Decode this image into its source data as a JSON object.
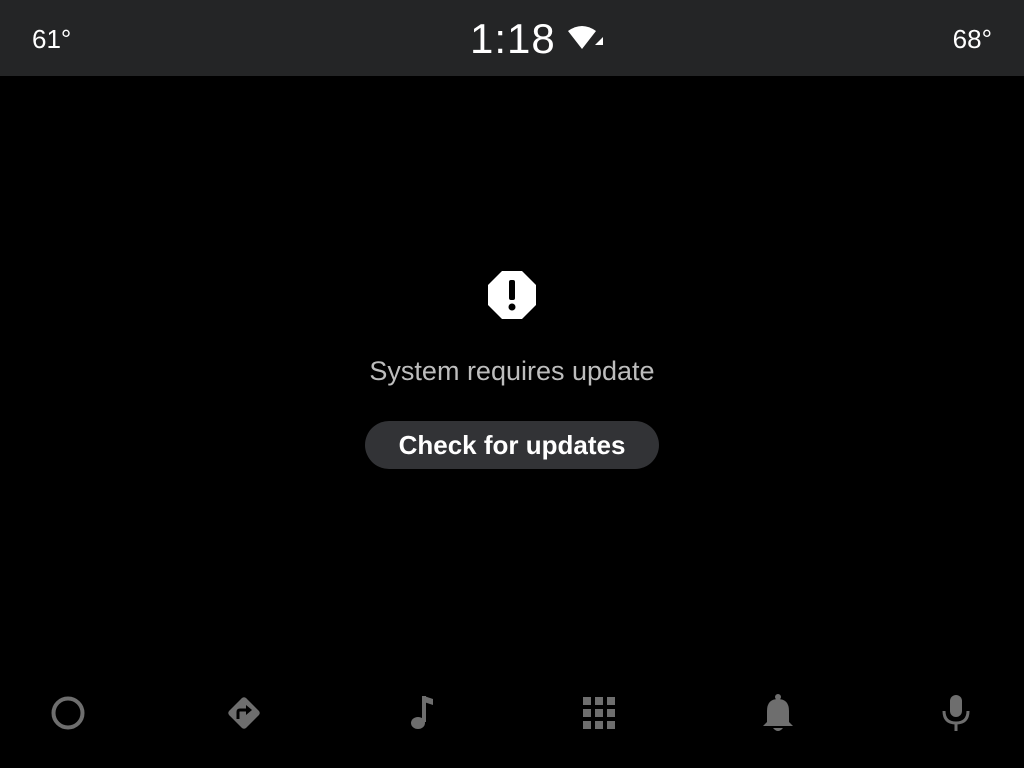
{
  "status_bar": {
    "temp_left": "61°",
    "time": "1:18",
    "temp_right": "68°",
    "signal_icon": "wifi-signal-icon"
  },
  "main": {
    "alert_icon": "alert-octagon-icon",
    "message": "System requires update",
    "button_label": "Check for updates"
  },
  "nav_bar": {
    "items": [
      {
        "icon": "home-circle-icon"
      },
      {
        "icon": "navigation-icon"
      },
      {
        "icon": "music-note-icon"
      },
      {
        "icon": "app-grid-icon"
      },
      {
        "icon": "bell-icon"
      },
      {
        "icon": "microphone-icon"
      }
    ]
  },
  "colors": {
    "background": "#000000",
    "status_bar": "#242526",
    "button": "#323336",
    "message_text": "#bdbdbd",
    "nav_icon": "#6e6e6e"
  }
}
